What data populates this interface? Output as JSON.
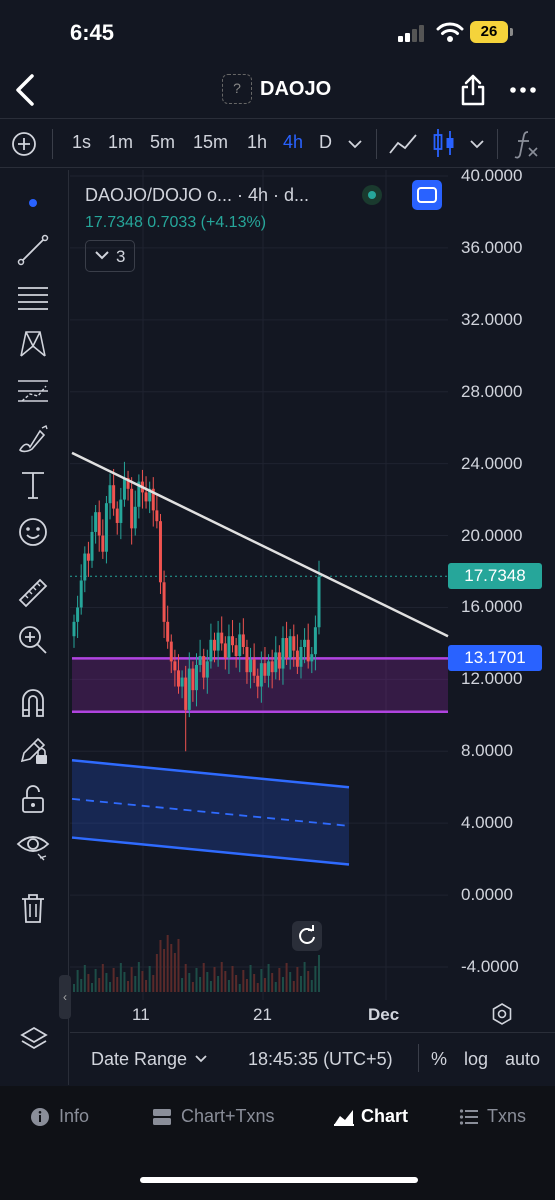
{
  "status": {
    "time": "6:45",
    "battery": "26"
  },
  "nav": {
    "token_placeholder": "?",
    "title": "DAOJO"
  },
  "toolbar": {
    "timeframes": [
      "1s",
      "1m",
      "5m",
      "15m",
      "1h",
      "4h",
      "D"
    ],
    "active_timeframe": "4h"
  },
  "legend": {
    "title": "DAOJO/DOJO o... · 4h · d...",
    "values": "17.7348  0.7033 (+4.13%)",
    "indicator_count": "3"
  },
  "price_scale": {
    "ticks": [
      "40.0000",
      "36.0000",
      "32.0000",
      "28.0000",
      "24.0000",
      "20.0000",
      "16.0000",
      "12.0000",
      "8.0000",
      "4.0000",
      "0.0000",
      "-4.0000"
    ],
    "last_price": "17.7348",
    "last_price_color": "#26a69a",
    "level_price": "13.1701",
    "level_price_color": "#2962ff"
  },
  "time_scale": {
    "ticks": [
      "11",
      "21",
      "Dec"
    ]
  },
  "range_bar": {
    "date_range": "Date Range",
    "clock": "18:45:35 (UTC+5)",
    "percent": "%",
    "log": "log",
    "auto": "auto"
  },
  "tabs": [
    {
      "label": "Info",
      "icon": "info-icon"
    },
    {
      "label": "Chart+Txns",
      "icon": "split-view-icon"
    },
    {
      "label": "Chart",
      "icon": "chart-icon",
      "active": true
    },
    {
      "label": "Txns",
      "icon": "list-icon"
    }
  ],
  "chart_data": {
    "type": "candlestick",
    "title": "DAOJO/DOJO o... · 4h · d...",
    "ylim": [
      -4,
      40
    ],
    "x_ticks": [
      "11",
      "21",
      "Dec"
    ],
    "last_close": 17.7348,
    "change": 0.7033,
    "change_pct": 4.13,
    "closes": [
      15.2,
      16.0,
      17.5,
      19.0,
      18.6,
      20.2,
      21.3,
      20.0,
      19.1,
      21.8,
      22.8,
      21.5,
      20.7,
      22.0,
      23.2,
      22.6,
      20.4,
      21.6,
      23.0,
      22.4,
      21.9,
      22.6,
      21.4,
      20.8,
      17.4,
      15.2,
      14.1,
      13.0,
      12.5,
      11.6,
      12.1,
      10.3,
      12.6,
      11.4,
      12.8,
      13.3,
      12.1,
      13.0,
      14.2,
      13.6,
      14.6,
      14.0,
      13.2,
      14.4,
      13.9,
      13.3,
      14.5,
      13.8,
      12.4,
      13.1,
      12.2,
      11.6,
      12.9,
      12.2,
      13.0,
      12.4,
      13.5,
      12.6,
      14.3,
      13.2,
      14.4,
      13.6,
      12.7,
      13.8,
      14.2,
      13.0,
      13.4,
      14.9,
      17.7
    ],
    "horizontal_zone": {
      "upper": 13.1701,
      "lower": 10.2
    },
    "channel": {
      "upper_start": 7.5,
      "upper_end": 6.0,
      "lower_start": 3.2,
      "lower_end": 1.7
    },
    "trendline": {
      "start": 24.6,
      "end": 14.4
    },
    "grid": true,
    "colors": {
      "up": "#26a69a",
      "down": "#ef5350",
      "zone": "#9c27b0",
      "channel": "#2962ff",
      "trendline": "#e0e0e0"
    }
  }
}
